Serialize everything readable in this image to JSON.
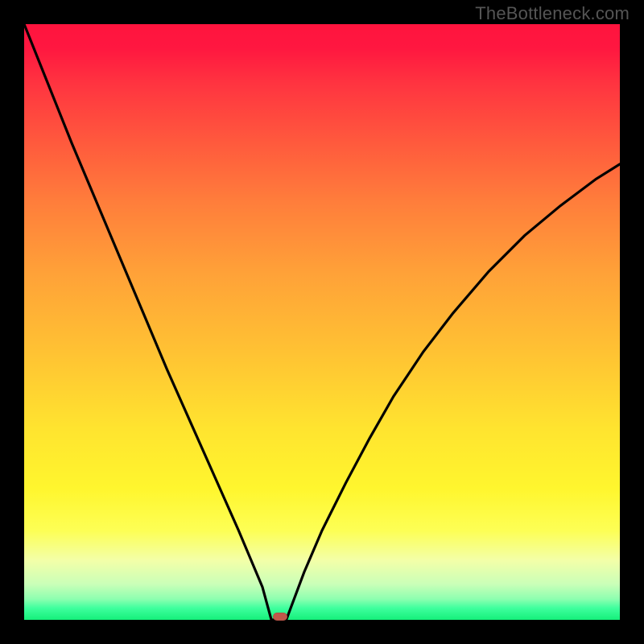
{
  "watermark": "TheBottleneck.com",
  "chart_data": {
    "type": "line",
    "title": "",
    "xlabel": "",
    "ylabel": "",
    "xlim": [
      0,
      100
    ],
    "ylim": [
      0,
      100
    ],
    "grid": false,
    "legend": false,
    "background": "gradient red→yellow→green (vertical, top=100 red, bottom=0 green)",
    "series": [
      {
        "name": "left-branch",
        "x": [
          0,
          4,
          8,
          12,
          16,
          20,
          24,
          28,
          32,
          36,
          40,
          41.5
        ],
        "y": [
          100,
          90,
          80,
          70.5,
          61,
          51.5,
          42,
          33,
          24,
          15,
          5.5,
          0
        ]
      },
      {
        "name": "right-branch",
        "x": [
          44,
          47,
          50,
          54,
          58,
          62,
          67,
          72,
          78,
          84,
          90,
          96,
          100
        ],
        "y": [
          0,
          8,
          15,
          23,
          30.5,
          37.5,
          45,
          51.5,
          58.5,
          64.5,
          69.5,
          74,
          76.5
        ]
      }
    ],
    "annotations": [
      {
        "name": "minimum-marker",
        "x": 43,
        "y": 0.5,
        "shape": "rounded-rect",
        "color": "#c1584a"
      }
    ]
  },
  "colors": {
    "frame": "#000000",
    "curve": "#000000",
    "marker": "#c1584a",
    "watermark": "#555555"
  }
}
